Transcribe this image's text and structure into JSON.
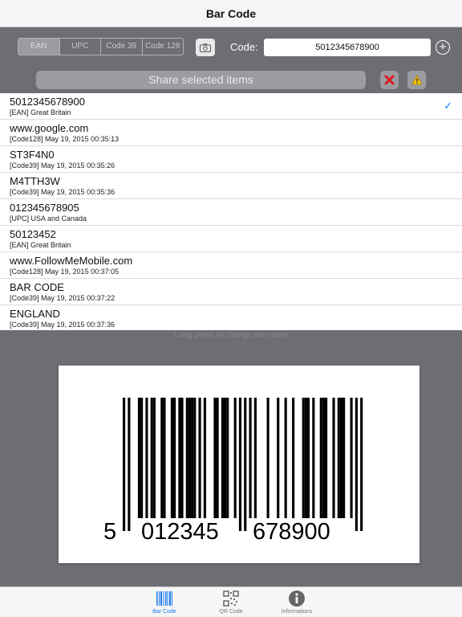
{
  "nav": {
    "title": "Bar Code"
  },
  "toolbar": {
    "segments": [
      "EAN",
      "UPC",
      "Code 39",
      "Code 128"
    ],
    "selected_segment": "EAN",
    "code_label": "Code:",
    "code_value": "5012345678900",
    "share_label": "Share selected items"
  },
  "items": [
    {
      "name": "5012345678900",
      "info": "[EAN] Great Britain",
      "checked": true
    },
    {
      "name": "www.google.com",
      "info": "[Code128] May 19, 2015 00:35:13",
      "checked": false
    },
    {
      "name": "ST3F4N0",
      "info": "[Code39] May 19, 2015 00:35:26",
      "checked": false
    },
    {
      "name": "M4TTH3W",
      "info": "[Code39] May 19, 2015 00:35:36",
      "checked": false
    },
    {
      "name": "012345678905",
      "info": "[UPC] USA and Canada",
      "checked": false
    },
    {
      "name": "50123452",
      "info": "[EAN] Great Britain",
      "checked": false
    },
    {
      "name": "www.FollowMeMobile.com",
      "info": "[Code128] May 19, 2015 00:37:05",
      "checked": false
    },
    {
      "name": "BAR CODE",
      "info": "[Code39] May 19, 2015 00:37:22",
      "checked": false
    },
    {
      "name": "ENGLAND",
      "info": "[Code39] May 19, 2015 00:37:36",
      "checked": false
    }
  ],
  "hint": "Long press to change the name",
  "barcode": {
    "first_digit": "5",
    "left_group": "012345",
    "right_group": "678900"
  },
  "tabs": [
    {
      "label": "Bar Code",
      "icon": "barcode-icon",
      "active": true
    },
    {
      "label": "QR Code",
      "icon": "qr-code-icon",
      "active": false
    },
    {
      "label": "Informations",
      "icon": "info-icon",
      "active": false
    }
  ],
  "colors": {
    "accent": "#1a7bf0",
    "toolbar_bg": "#6d6e73",
    "clear_red": "#e0191f",
    "warning_yellow": "#f5c400"
  }
}
